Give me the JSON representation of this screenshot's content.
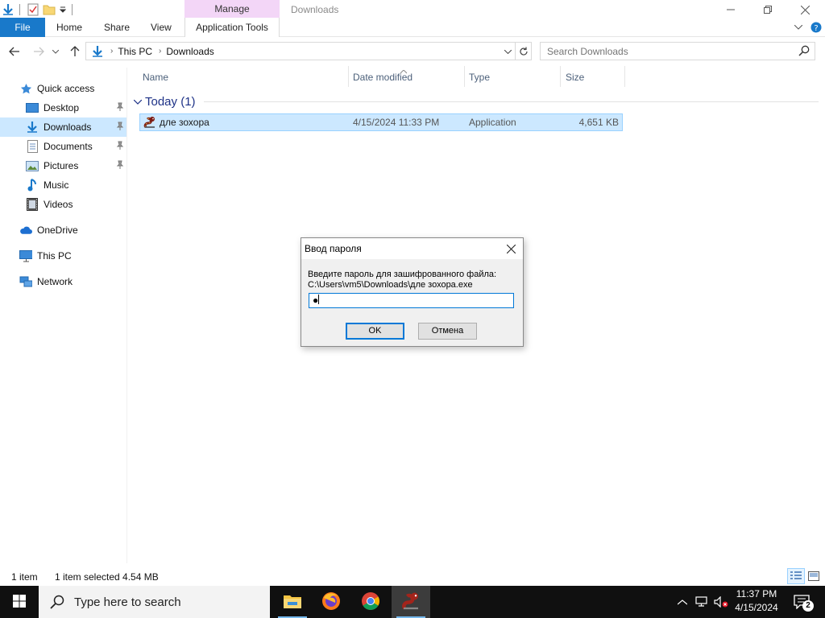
{
  "window": {
    "title": "Downloads",
    "manage_label": "Manage",
    "app_tools_label": "Application Tools"
  },
  "ribbon": {
    "tabs": [
      "File",
      "Home",
      "Share",
      "View"
    ]
  },
  "address": {
    "crumbs": [
      "This PC",
      "Downloads"
    ],
    "search_placeholder": "Search Downloads"
  },
  "nav": {
    "items": [
      {
        "label": "Quick access",
        "icon": "star-icon"
      },
      {
        "label": "Desktop",
        "icon": "desktop-icon",
        "pinned": true
      },
      {
        "label": "Downloads",
        "icon": "download-icon",
        "pinned": true,
        "selected": true
      },
      {
        "label": "Documents",
        "icon": "document-icon",
        "pinned": true
      },
      {
        "label": "Pictures",
        "icon": "picture-icon",
        "pinned": true
      },
      {
        "label": "Music",
        "icon": "music-icon"
      },
      {
        "label": "Videos",
        "icon": "video-icon"
      },
      {
        "label": "OneDrive",
        "icon": "cloud-icon"
      },
      {
        "label": "This PC",
        "icon": "computer-icon"
      },
      {
        "label": "Network",
        "icon": "network-icon"
      }
    ]
  },
  "columns": [
    "Name",
    "Date modified",
    "Type",
    "Size"
  ],
  "group": {
    "label": "Today (1)"
  },
  "files": [
    {
      "name": "дле зохора",
      "date": "4/15/2024 11:33 PM",
      "type": "Application",
      "size": "4,651 KB",
      "icon": "snake-app-icon"
    }
  ],
  "status": {
    "count": "1 item",
    "selection": "1 item selected  4.54 MB"
  },
  "dialog": {
    "title": "Ввод пароля",
    "prompt_line1": "Введите пароль для зашифрованного файла:",
    "prompt_line2": "C:\\Users\\vm5\\Downloads\\дле зохора.exe",
    "password_mask": "●",
    "ok_label": "OK",
    "cancel_label": "Отмена"
  },
  "taskbar": {
    "search_text": "Type here to search",
    "apps": [
      "file-explorer-icon",
      "firefox-icon",
      "chrome-icon",
      "snake-app-icon"
    ],
    "time": "11:37 PM",
    "date": "4/15/2024",
    "notification_count": "2"
  },
  "colors": {
    "accent": "#1979ca",
    "selection": "#cce8ff",
    "manage_tab": "#f3d6f7",
    "taskbar": "#101010"
  }
}
